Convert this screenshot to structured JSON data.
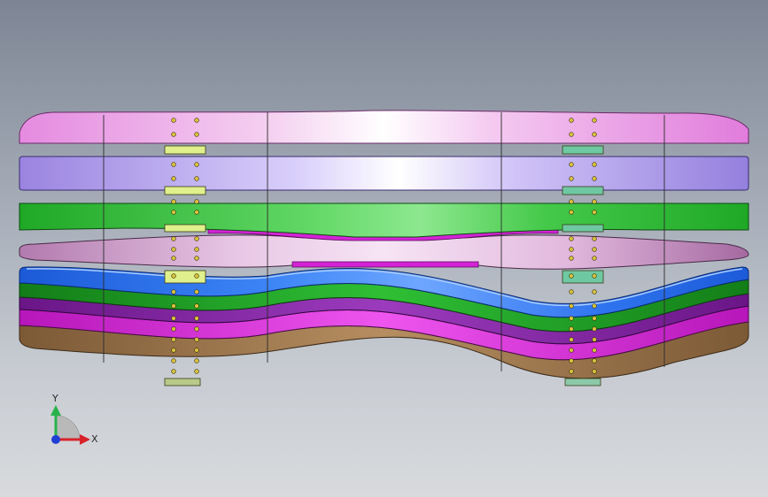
{
  "viewport": {
    "background_top": "#7d8594",
    "background_bottom": "#d8dadd"
  },
  "model": {
    "plates": [
      {
        "name": "top-pink-plate",
        "color": "#e58ae0",
        "highlight": "#f6d8f4"
      },
      {
        "name": "purple-plate",
        "color": "#9f8ae6",
        "highlight": "#ddd4fb"
      },
      {
        "name": "green-plate",
        "color": "#23b42a",
        "highlight": "#8ce88e"
      },
      {
        "name": "pink-lens-plate",
        "color": "#c98bc6",
        "highlight": "#f1d6ee"
      },
      {
        "name": "blue-wave-plate",
        "color": "#2167e6",
        "highlight": "#6ea6ff"
      },
      {
        "name": "green-wave-plate",
        "color": "#168d1c",
        "highlight": "#35c53b"
      },
      {
        "name": "purple-wave-plate",
        "color": "#7a1a9a",
        "highlight": "#a347c3"
      },
      {
        "name": "magenta-wave-plate",
        "color": "#c21cc4",
        "highlight": "#f05af0"
      },
      {
        "name": "brown-base-plate",
        "color": "#8f6a43",
        "highlight": "#c29a6c"
      }
    ],
    "accent_yellow": "#dff08c",
    "accent_teal": "#6ec9a2",
    "bolt_color": "#d9c23a"
  },
  "triad": {
    "x_label": "X",
    "y_label": "Y",
    "x_color": "#d8232a",
    "y_color": "#29b24a",
    "z_color": "#1f3fd6"
  }
}
